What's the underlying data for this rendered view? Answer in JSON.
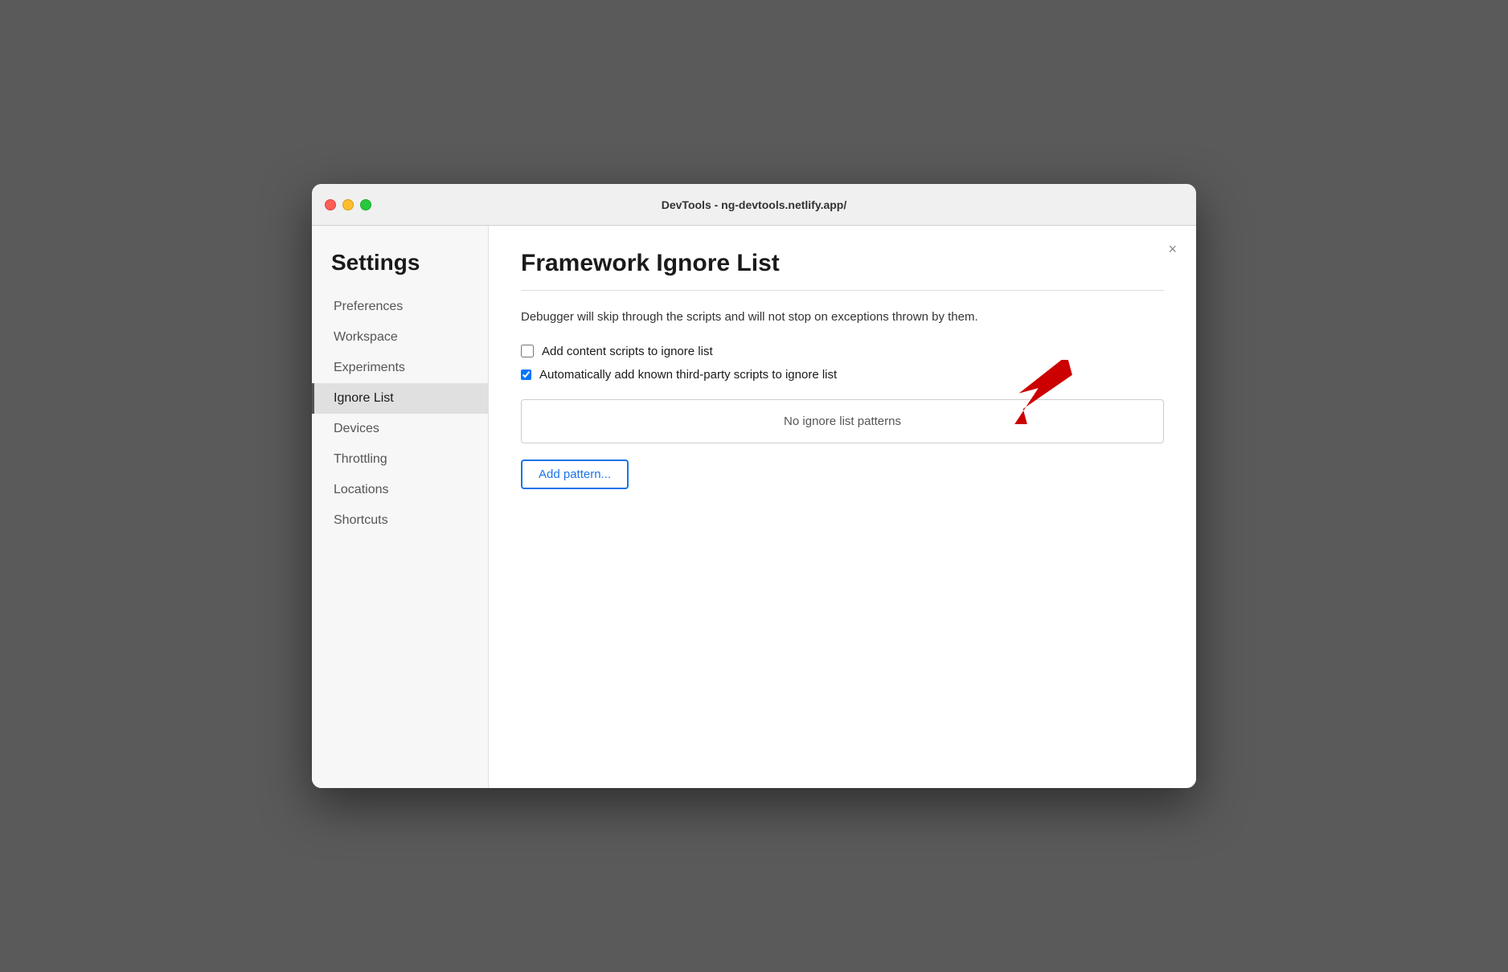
{
  "window": {
    "title": "DevTools - ng-devtools.netlify.app/"
  },
  "traffic_lights": {
    "close_label": "close",
    "minimize_label": "minimize",
    "maximize_label": "maximize"
  },
  "sidebar": {
    "heading": "Settings",
    "items": [
      {
        "id": "preferences",
        "label": "Preferences",
        "active": false
      },
      {
        "id": "workspace",
        "label": "Workspace",
        "active": false
      },
      {
        "id": "experiments",
        "label": "Experiments",
        "active": false
      },
      {
        "id": "ignore-list",
        "label": "Ignore List",
        "active": true
      },
      {
        "id": "devices",
        "label": "Devices",
        "active": false
      },
      {
        "id": "throttling",
        "label": "Throttling",
        "active": false
      },
      {
        "id": "locations",
        "label": "Locations",
        "active": false
      },
      {
        "id": "shortcuts",
        "label": "Shortcuts",
        "active": false
      }
    ]
  },
  "main": {
    "page_title": "Framework Ignore List",
    "description": "Debugger will skip through the scripts and will not stop on exceptions thrown by them.",
    "close_label": "×",
    "checkboxes": [
      {
        "id": "add-content-scripts",
        "label": "Add content scripts to ignore list",
        "checked": false
      },
      {
        "id": "auto-add-third-party",
        "label": "Automatically add known third-party scripts to ignore list",
        "checked": true
      }
    ],
    "patterns_placeholder": "No ignore list patterns",
    "add_pattern_button": "Add pattern..."
  }
}
